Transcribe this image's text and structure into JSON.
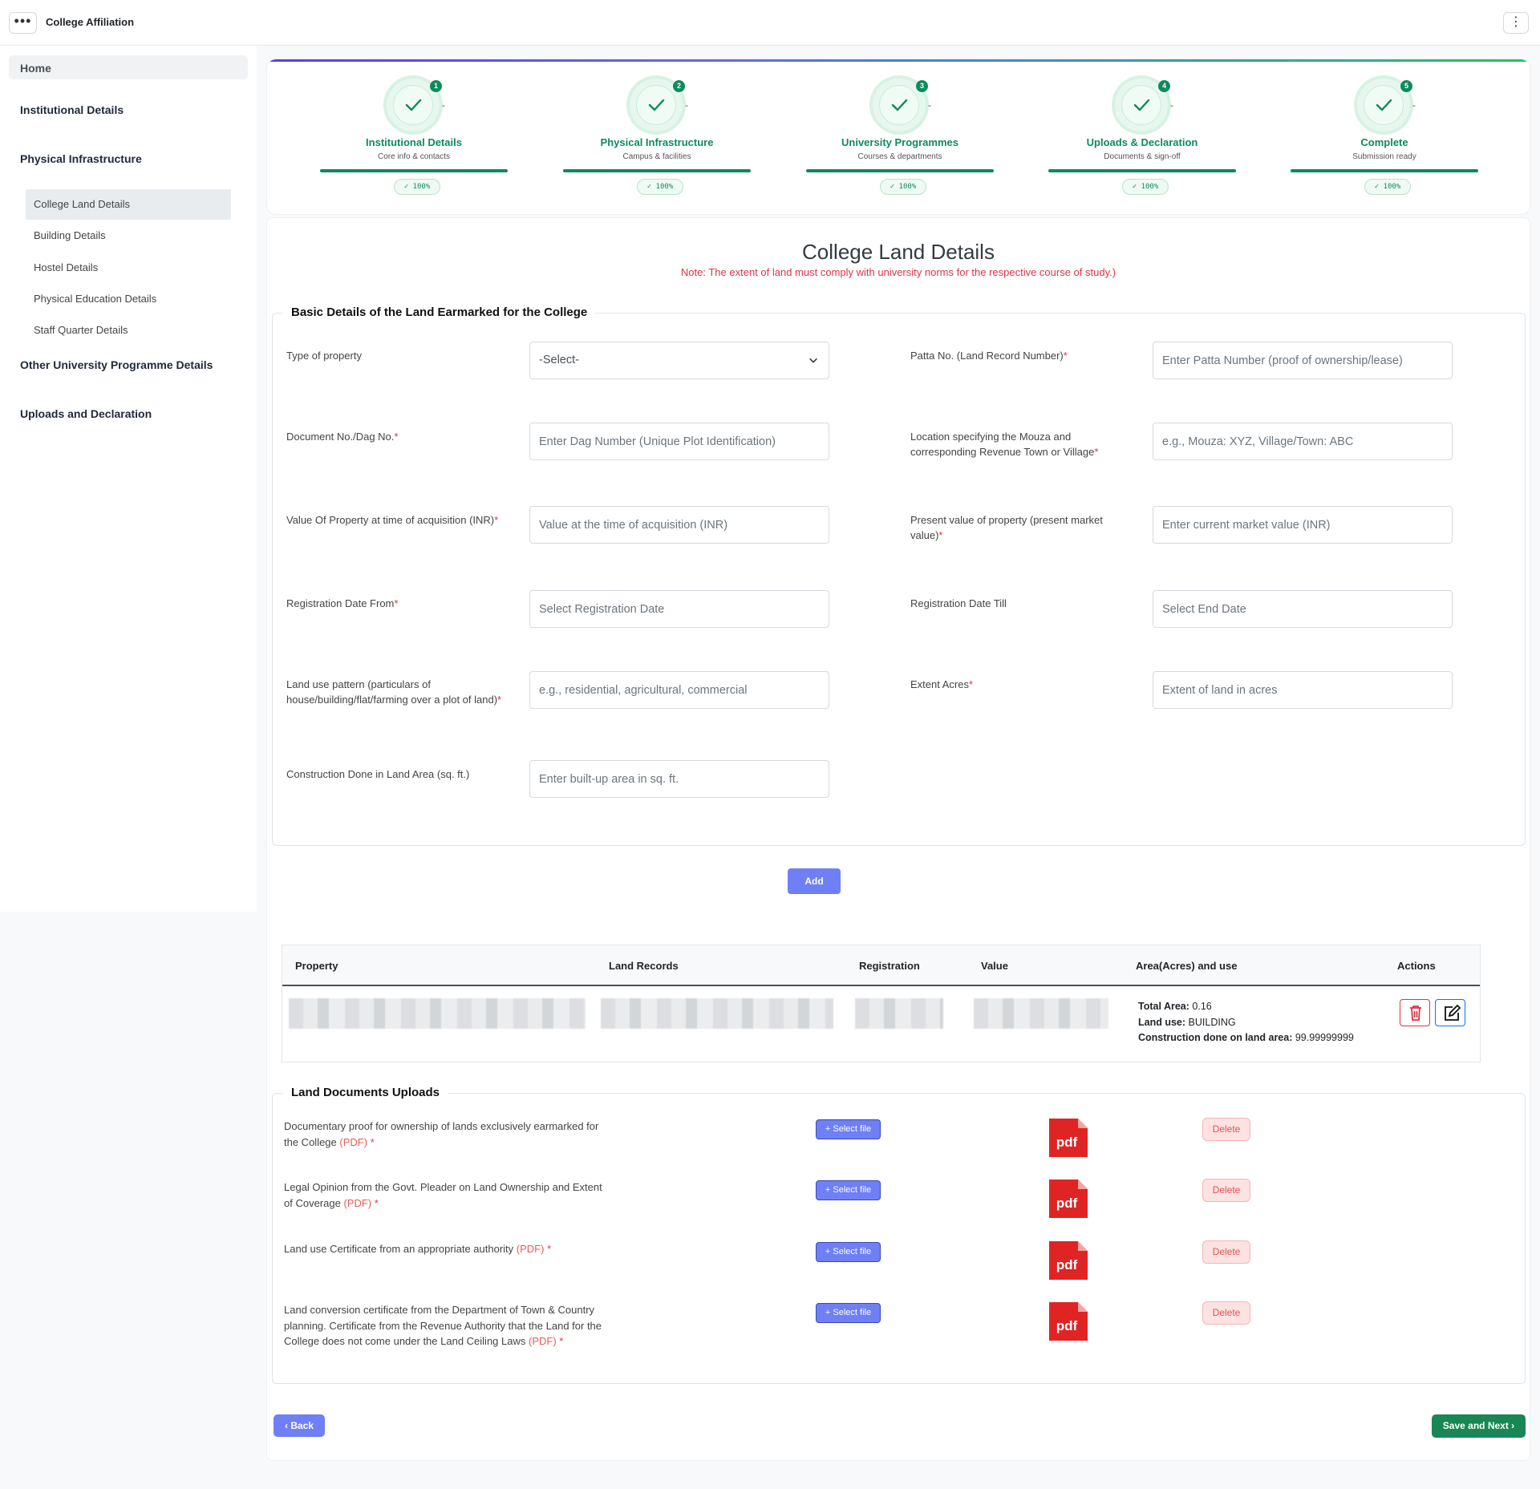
{
  "app": {
    "title": "College Affiliation",
    "menu_icon": "ellipsis-horizontal-icon",
    "more_icon": "ellipsis-vertical-icon"
  },
  "sidebar": {
    "home": "Home",
    "sections": [
      {
        "label": "Institutional Details"
      },
      {
        "label": "Physical Infrastructure"
      },
      {
        "label": "Other University Programme Details"
      },
      {
        "label": "Uploads and Declaration"
      }
    ],
    "sub_items": [
      {
        "label": "College Land Details",
        "active": true
      },
      {
        "label": "Building Details"
      },
      {
        "label": "Hostel Details"
      },
      {
        "label": "Physical Education Details"
      },
      {
        "label": "Staff Quarter Details"
      }
    ]
  },
  "stepper": {
    "steps": [
      {
        "number": "1",
        "title": "Institutional Details",
        "subtitle": "Core info & contacts",
        "progress": "100%"
      },
      {
        "number": "2",
        "title": "Physical Infrastructure",
        "subtitle": "Campus & facilities",
        "progress": "100%"
      },
      {
        "number": "3",
        "title": "University Programmes",
        "subtitle": "Courses & departments",
        "progress": "100%"
      },
      {
        "number": "4",
        "title": "Uploads & Declaration",
        "subtitle": "Documents & sign-off",
        "progress": "100%"
      },
      {
        "number": "5",
        "title": "Complete",
        "subtitle": "Submission ready",
        "progress": "100%"
      }
    ],
    "colors": {
      "accent": "#0e8a5f",
      "start": "#4f46e5"
    }
  },
  "page": {
    "title": "College Land Details",
    "note": "Note: The extent of land must comply with university norms for the respective course of study.)"
  },
  "basic_details": {
    "legend": "Basic Details of the Land Earmarked for the College",
    "fields": {
      "type_of_property": {
        "label": "Type of property",
        "value": "-Select-"
      },
      "patta_no": {
        "label": "Patta No. (Land Record Number)",
        "placeholder": "Enter Patta Number (proof of ownership/lease)"
      },
      "document_no": {
        "label": "Document No./Dag No.",
        "placeholder": "Enter Dag Number (Unique Plot Identification)"
      },
      "location": {
        "label": "Location specifying the Mouza and corresponding Revenue Town or Village",
        "placeholder": "e.g., Mouza: XYZ, Village/Town: ABC"
      },
      "value_acquisition": {
        "label": "Value Of Property at time of acquisition (INR)",
        "placeholder": "Value at the time of acquisition (INR)"
      },
      "present_value": {
        "label": "Present value of property (present market value)",
        "placeholder": "Enter current market value (INR)"
      },
      "reg_date_from": {
        "label": "Registration Date From",
        "placeholder": "Select Registration Date"
      },
      "reg_date_till": {
        "label": "Registration Date Till",
        "placeholder": "Select End Date"
      },
      "land_use_pattern": {
        "label": "Land use pattern (particulars of house/building/flat/farming over a plot of land)",
        "placeholder": "e.g., residential, agricultural, commercial"
      },
      "extent_acres": {
        "label": "Extent Acres",
        "placeholder": "Extent of land in acres"
      },
      "construction_area": {
        "label": "Construction Done in Land Area (sq. ft.)",
        "placeholder": "Enter built-up area in sq. ft."
      }
    },
    "add_label": "Add"
  },
  "table": {
    "headers": [
      "Property",
      "Land Records",
      "Registration",
      "Value",
      "Area(Acres) and use",
      "Actions"
    ],
    "row": {
      "total_area_label": "Total Area:",
      "total_area": "0.16",
      "land_use_label": "Land use:",
      "land_use": "BUILDING",
      "construction_label": "Construction done on land area:",
      "construction": "99.99999999"
    }
  },
  "uploads": {
    "legend": "Land Documents Uploads",
    "select_label": "+ Select file",
    "delete_label": "Delete",
    "pdf_text": "pdf",
    "pdf_tag": "(PDF)",
    "required_mark": "*",
    "items": [
      {
        "label": "Documentary proof for ownership of lands exclusively earmarked for the College"
      },
      {
        "label": "Legal Opinion from the Govt. Pleader on Land Ownership and Extent of Coverage"
      },
      {
        "label": "Land use Certificate from an appropriate authority"
      },
      {
        "label": "Land conversion certificate from the Department of Town & Country planning. Certificate from the Revenue Authority that the Land for the College does not come under the Land Ceiling Laws"
      }
    ]
  },
  "footer": {
    "back_label": "Back",
    "save_label": "Save and Next"
  }
}
